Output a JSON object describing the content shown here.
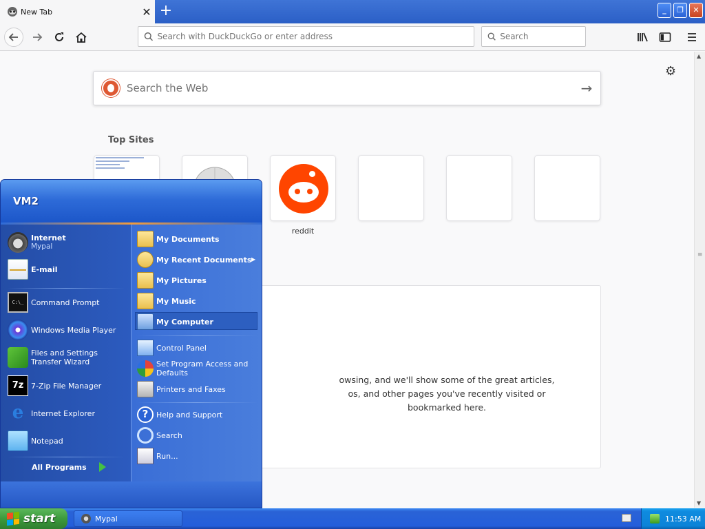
{
  "browser": {
    "tab": {
      "title": "New Tab",
      "close_glyph": "✕"
    },
    "new_tab_glyph": "+",
    "window_buttons": {
      "minimize": "_",
      "maximize": "❐",
      "close": "✕"
    },
    "urlbar": {
      "placeholder": "Search with DuckDuckGo or enter address",
      "value": ""
    },
    "searchbar": {
      "placeholder": "Search",
      "value": ""
    }
  },
  "page": {
    "web_search": {
      "placeholder": "Search the Web",
      "submit_glyph": "→"
    },
    "top_sites": {
      "heading": "Top Sites",
      "tiles": [
        {
          "label": ""
        },
        {
          "label": ""
        },
        {
          "label": "reddit"
        },
        {
          "label": ""
        },
        {
          "label": ""
        },
        {
          "label": ""
        }
      ]
    },
    "highlights": {
      "message": "owsing, and we'll show some of the great articles,\nos, and other pages you've recently visited or\nbookmarked here."
    }
  },
  "start_menu": {
    "user": "VM2",
    "pinned": [
      {
        "title": "Internet",
        "subtitle": "Mypal",
        "icon": "raccoon-icon"
      },
      {
        "title": "E-mail",
        "subtitle": "",
        "icon": "mail-icon"
      }
    ],
    "recent_programs": [
      {
        "label": "Command Prompt",
        "icon": "command-prompt-icon"
      },
      {
        "label": "Windows Media Player",
        "icon": "media-player-icon"
      },
      {
        "label": "Files and Settings Transfer Wizard",
        "icon": "transfer-wizard-icon"
      },
      {
        "label": "7-Zip File Manager",
        "icon": "7zip-icon"
      },
      {
        "label": "Internet Explorer",
        "icon": "internet-explorer-icon"
      },
      {
        "label": "Notepad",
        "icon": "notepad-icon"
      }
    ],
    "all_programs": "All Programs",
    "places": [
      {
        "label": "My Documents",
        "icon": "folder-icon"
      },
      {
        "label": "My Recent Documents",
        "icon": "recent-documents-icon"
      },
      {
        "label": "My Pictures",
        "icon": "folder-icon"
      },
      {
        "label": "My Music",
        "icon": "folder-icon"
      },
      {
        "label": "My Computer",
        "icon": "computer-icon"
      }
    ],
    "system": [
      {
        "label": "Control Panel",
        "icon": "control-panel-icon"
      },
      {
        "label": "Set Program Access and Defaults",
        "icon": "program-access-icon"
      },
      {
        "label": "Printers and Faxes",
        "icon": "printer-icon"
      }
    ],
    "tools": [
      {
        "label": "Help and Support",
        "icon": "help-icon"
      },
      {
        "label": "Search",
        "icon": "search-icon"
      },
      {
        "label": "Run...",
        "icon": "run-icon"
      }
    ],
    "ie_glyph": "e",
    "zip_glyph": "7z",
    "cmd_glyph": "C:\\_",
    "help_glyph": "?"
  },
  "taskbar": {
    "start_label": "start",
    "tasks": [
      {
        "label": "Mypal"
      }
    ],
    "clock": "11:53 AM"
  },
  "colors": {
    "xp_blue": "#245edb",
    "start_green": "#3c9a3c",
    "reddit_orange": "#ff4500",
    "ddg_orange": "#de5833"
  }
}
